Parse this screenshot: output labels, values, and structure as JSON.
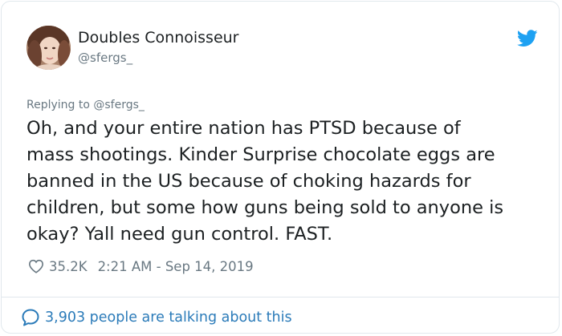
{
  "author": {
    "display_name": "Doubles Connoisseur",
    "handle": "@sfergs_",
    "avatar_icon": "profile-photo"
  },
  "replying_to": "Replying to @sfergs_",
  "tweet": {
    "lines": [
      "Oh, and your entire nation has PTSD because of",
      "mass shootings. Kinder Surprise chocolate eggs are",
      "banned in the US because of choking hazards for",
      "children, but some how guns being sold to anyone is",
      "okay? Yall need gun control. FAST."
    ]
  },
  "meta": {
    "likes": "35.2K",
    "timestamp": "2:21 AM - Sep 14, 2019"
  },
  "footer": {
    "talking": "3,903 people are talking about this"
  },
  "colors": {
    "text": "#1c2022",
    "secondary": "#697882",
    "link": "#2b7bb9",
    "twitter_blue": "#1da1f2",
    "border": "#e1e8ed"
  }
}
